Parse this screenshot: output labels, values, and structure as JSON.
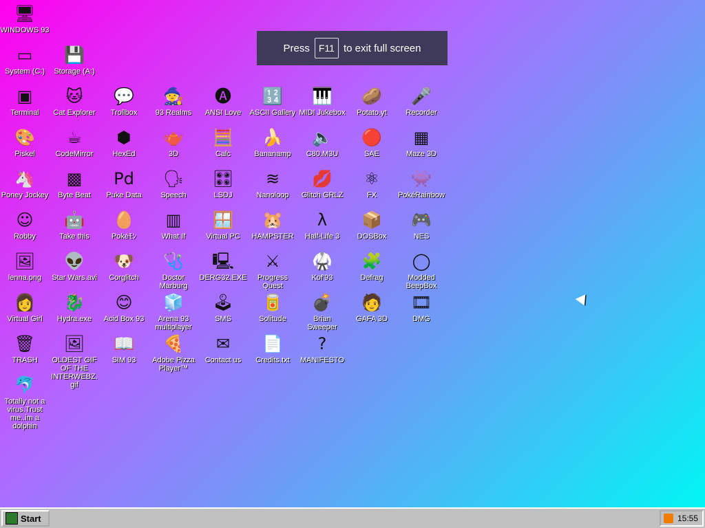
{
  "banner": {
    "press": "Press",
    "key": "F11",
    "rest": "to exit full screen"
  },
  "icons": [
    {
      "label": "WINDOWS 93",
      "glyph": "🖥"
    },
    {
      "label": "System (C:)",
      "glyph": "▭"
    },
    {
      "label": "Storage (A:)",
      "glyph": "💾"
    },
    {
      "label": "Terminal",
      "glyph": "▣"
    },
    {
      "label": "Cat Explorer",
      "glyph": "🐱"
    },
    {
      "label": "Trollbox",
      "glyph": "💬"
    },
    {
      "label": "93 Realms",
      "glyph": "🧙"
    },
    {
      "label": "ANSI Love",
      "glyph": "🅐"
    },
    {
      "label": "ASCII Gallery",
      "glyph": "🔢"
    },
    {
      "label": "MIDI Jukebox",
      "glyph": "🎹"
    },
    {
      "label": "Potato.yt",
      "glyph": "🥔"
    },
    {
      "label": "Recorder",
      "glyph": "🎤"
    },
    {
      "label": "Piskel",
      "glyph": "🎨"
    },
    {
      "label": "CodeMirror",
      "glyph": "☕"
    },
    {
      "label": "HexEd",
      "glyph": "⬢"
    },
    {
      "label": "3D",
      "glyph": "🫖"
    },
    {
      "label": "Calc",
      "glyph": "🧮"
    },
    {
      "label": "Bananamp",
      "glyph": "🍌"
    },
    {
      "label": "C80.M3U",
      "glyph": "🔈"
    },
    {
      "label": "SAE",
      "glyph": "🔴"
    },
    {
      "label": "Maze 3D",
      "glyph": "▦"
    },
    {
      "label": "Poney Jockey",
      "glyph": "🦄"
    },
    {
      "label": "Byte Beat",
      "glyph": "▩"
    },
    {
      "label": "Puke Data",
      "glyph": "Pd"
    },
    {
      "label": "Speech",
      "glyph": "🗣"
    },
    {
      "label": "LSDJ",
      "glyph": "🎛"
    },
    {
      "label": "Nanoloop",
      "glyph": "≋"
    },
    {
      "label": "Glitch GRLZ",
      "glyph": "💋"
    },
    {
      "label": "FX",
      "glyph": "⚛"
    },
    {
      "label": "PokéRainbow",
      "glyph": "👾"
    },
    {
      "label": "Robby",
      "glyph": "☺"
    },
    {
      "label": "Take this",
      "glyph": "🤖"
    },
    {
      "label": "Pokéﾓﾝ",
      "glyph": "🥚"
    },
    {
      "label": "What If",
      "glyph": "▥"
    },
    {
      "label": "Virtual PC",
      "glyph": "🪟"
    },
    {
      "label": "HAMPSTER",
      "glyph": "🐹"
    },
    {
      "label": "Half-Life 3",
      "glyph": "λ"
    },
    {
      "label": "DOSBox",
      "glyph": "📦"
    },
    {
      "label": "NES",
      "glyph": "🎮"
    },
    {
      "label": "lenna.png",
      "glyph": "🖼"
    },
    {
      "label": "Star Wars.avi",
      "glyph": "👽"
    },
    {
      "label": "Corglitch",
      "glyph": "🐶"
    },
    {
      "label": "Doctor Marburg",
      "glyph": "🩺"
    },
    {
      "label": "DERG32.EXE",
      "glyph": "🖳"
    },
    {
      "label": "Progress Quest",
      "glyph": "⚔"
    },
    {
      "label": "Kof'93",
      "glyph": "🥋"
    },
    {
      "label": "Defrag",
      "glyph": "🧩"
    },
    {
      "label": "Modded BeepBox",
      "glyph": "◯"
    },
    {
      "label": "Virtual Girl",
      "glyph": "👩"
    },
    {
      "label": "Hydra.exe",
      "glyph": "🐉"
    },
    {
      "label": "Acid Box 93",
      "glyph": "😊"
    },
    {
      "label": "Arena 93 multiplayer",
      "glyph": "🧊"
    },
    {
      "label": "SMS",
      "glyph": "🕹"
    },
    {
      "label": "Solitude",
      "glyph": "🥫"
    },
    {
      "label": "Brian Sweeper",
      "glyph": "💣"
    },
    {
      "label": "GAFA 3D",
      "glyph": "🧑"
    },
    {
      "label": "DMG",
      "glyph": "🎞"
    },
    {
      "label": "TRASH",
      "glyph": "🗑"
    },
    {
      "label": "OLDEST GIF OF THE INTERWEBZ.gif",
      "glyph": "🖼"
    },
    {
      "label": "SIM 93",
      "glyph": "📖"
    },
    {
      "label": "Adobe Pizza Player™",
      "glyph": "🍕"
    },
    {
      "label": "Contact us",
      "glyph": "✉"
    },
    {
      "label": "Credits.txt",
      "glyph": "📄"
    },
    {
      "label": "MANIFESTO",
      "glyph": "?"
    },
    {
      "label": "Totally not a virus.Trust me..im a dolphin",
      "glyph": "🐬"
    }
  ],
  "taskbar": {
    "start_label": "Start",
    "clock": "15:55"
  }
}
